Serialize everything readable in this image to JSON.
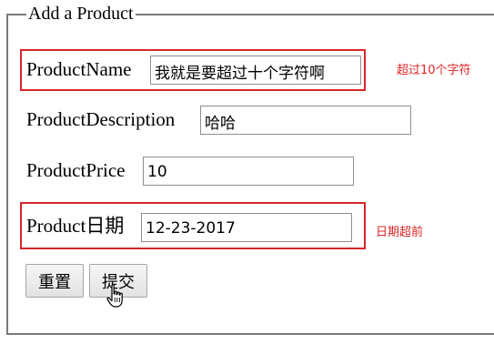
{
  "form": {
    "legend": "Add a Product",
    "fields": [
      {
        "label": "ProductName",
        "value": "我就是要超过十个字符啊"
      },
      {
        "label": "ProductDescription",
        "value": "哈哈"
      },
      {
        "label": "ProductPrice",
        "value": "10"
      },
      {
        "label": "Product日期",
        "value": "12-23-2017"
      }
    ],
    "buttons": {
      "reset_label": "重置",
      "submit_label": "提交"
    }
  },
  "annotations": {
    "name_error": "超过10个字符",
    "date_error": "日期超前"
  },
  "colors": {
    "highlight_border": "#d9262a",
    "annotation_text": "#e02525",
    "fieldset_border": "#7a7a7a"
  },
  "icons": {
    "cursor": "hand-pointer-icon"
  }
}
